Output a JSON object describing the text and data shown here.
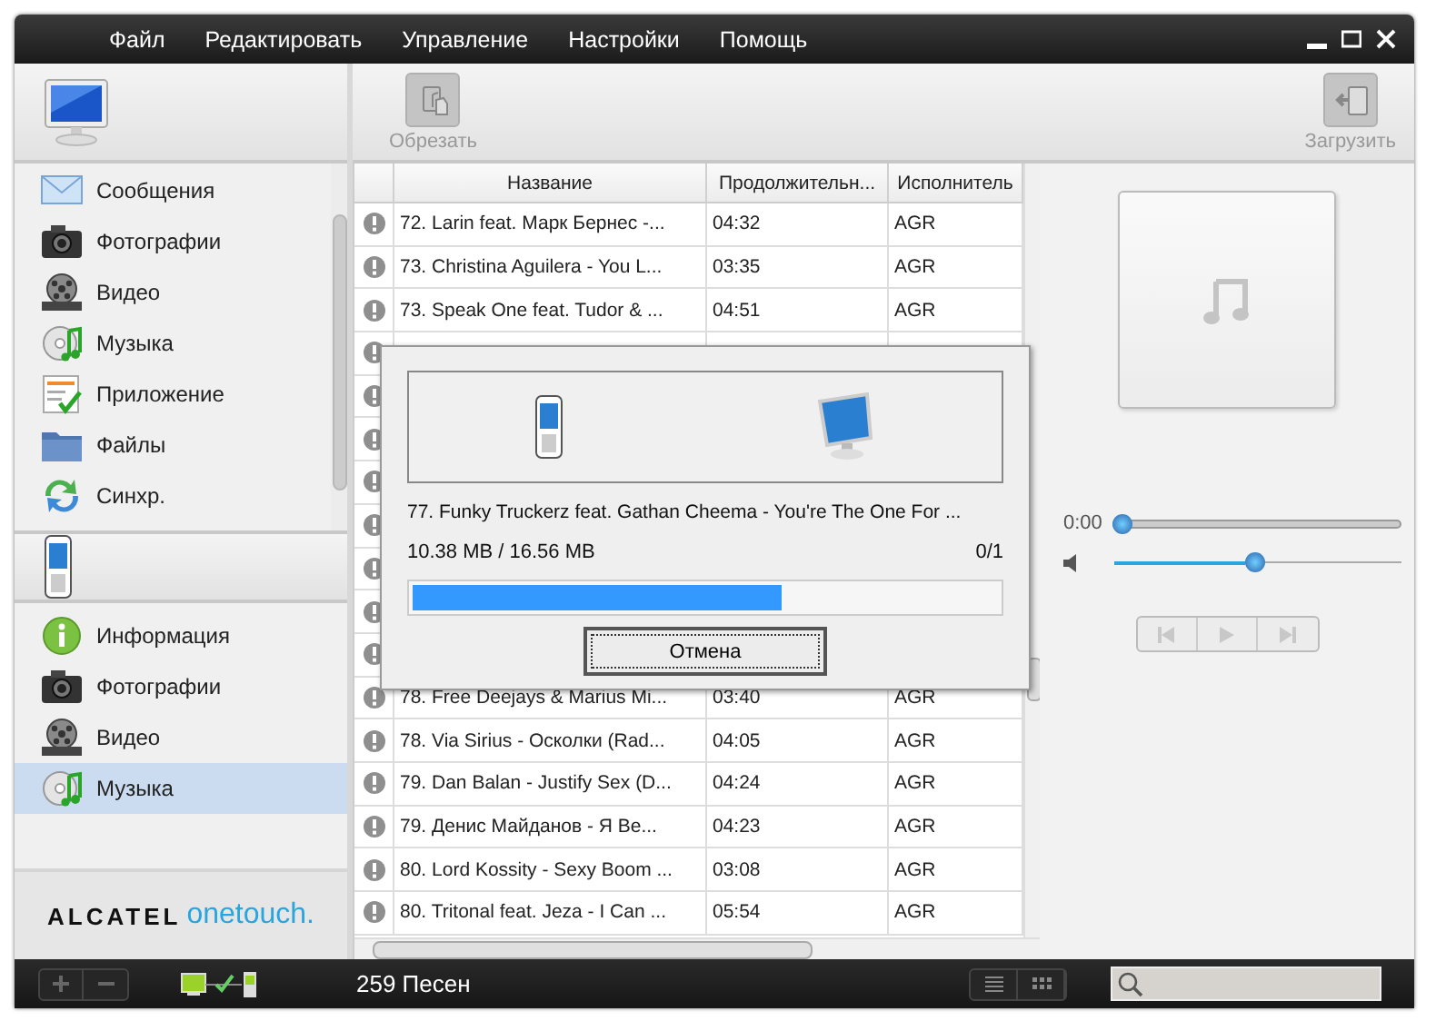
{
  "menu": [
    "Файл",
    "Редактировать",
    "Управление",
    "Настройки",
    "Помощь"
  ],
  "toolbar": [
    {
      "kind": "trim",
      "label": "Обрезать",
      "disabled": true
    },
    {
      "kind": "upload",
      "label": "Загрузить",
      "disabled": true
    }
  ],
  "sidebar": {
    "computer_items": [
      {
        "kind": "message",
        "label": "Сообщения",
        "selected": false
      },
      {
        "kind": "photo",
        "label": "Фотографии",
        "selected": false
      },
      {
        "kind": "video",
        "label": "Видео",
        "selected": false
      },
      {
        "kind": "music",
        "label": "Музыка",
        "selected": false
      },
      {
        "kind": "app",
        "label": "Приложение",
        "selected": false
      },
      {
        "kind": "files",
        "label": "Файлы",
        "selected": false
      },
      {
        "kind": "sync",
        "label": "Синхр.",
        "selected": false
      }
    ],
    "phone_items": [
      {
        "kind": "info",
        "label": "Информация",
        "selected": false
      },
      {
        "kind": "photo",
        "label": "Фотографии",
        "selected": false
      },
      {
        "kind": "video",
        "label": "Видео",
        "selected": false
      },
      {
        "kind": "music",
        "label": "Музыка",
        "selected": true
      }
    ],
    "logo": {
      "brand": "ALCATEL",
      "product": "onetouch."
    }
  },
  "table": {
    "columns": [
      "Название",
      "Продолжительн...",
      "Исполнитель"
    ],
    "rows": [
      {
        "kind": "track",
        "cells": [
          "72. Larin feat. Марк Бернес -...",
          "04:32",
          "AGR"
        ]
      },
      {
        "kind": "track",
        "cells": [
          "73. Christina Aguilera - You L...",
          "03:35",
          "AGR"
        ]
      },
      {
        "kind": "track",
        "cells": [
          "73. Speak One feat. Tudor & ...",
          "04:51",
          "AGR"
        ]
      },
      {
        "kind": "covered"
      },
      {
        "kind": "covered"
      },
      {
        "kind": "covered"
      },
      {
        "kind": "covered"
      },
      {
        "kind": "covered"
      },
      {
        "kind": "covered"
      },
      {
        "kind": "covered"
      },
      {
        "kind": "covered"
      },
      {
        "kind": "track",
        "cells": [
          "78. Free Deejays & Marius Mi...",
          "03:40",
          "AGR"
        ]
      },
      {
        "kind": "track",
        "cells": [
          "78. Via Sirius - Осколки (Rad...",
          "04:05",
          "AGR"
        ]
      },
      {
        "kind": "track",
        "cells": [
          "79. Dan Balan - Justify Sex (D...",
          "04:24",
          "AGR"
        ]
      },
      {
        "kind": "track",
        "cells": [
          "79. Денис Майданов - Я Ве...",
          "04:23",
          "AGR"
        ]
      },
      {
        "kind": "track",
        "cells": [
          "80. Lord Kossity - Sexy Boom ...",
          "03:08",
          "AGR"
        ]
      },
      {
        "kind": "track",
        "cells": [
          "80. Tritonal feat. Jeza - I Can ...",
          "05:54",
          "AGR"
        ]
      }
    ]
  },
  "transfer_dialog": {
    "track": "77. Funky Truckerz feat. Gathan Cheema - You're The One For ...",
    "size": "10.38 MB / 16.56 MB",
    "count": "0/1",
    "level": 0.63,
    "cancel_button": "Отмена"
  },
  "player": {
    "time": "0:00",
    "position": {
      "level": 0
    },
    "volume": {
      "level": 0.49
    },
    "controls": [
      {
        "kind": "previous",
        "disabled": true
      },
      {
        "kind": "play",
        "disabled": true
      },
      {
        "kind": "next",
        "disabled": true
      }
    ]
  },
  "status_bar": {
    "song_count": "259 Песен"
  }
}
